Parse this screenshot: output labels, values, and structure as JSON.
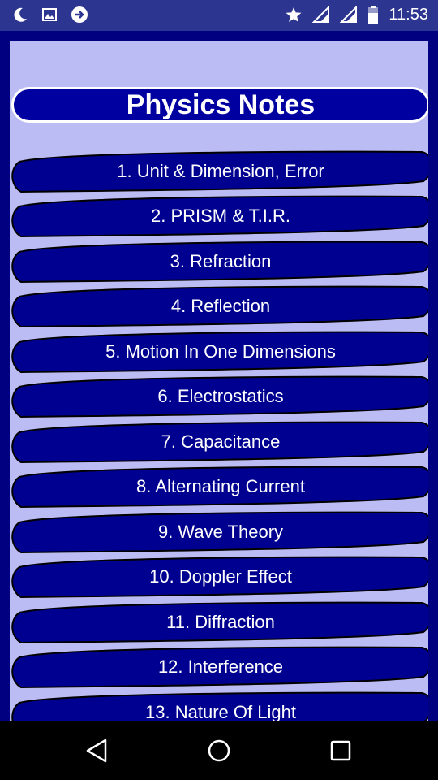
{
  "status_bar": {
    "time": "11:53",
    "icons_left": [
      "moon-icon",
      "image-icon",
      "sync-icon"
    ],
    "icons_right": [
      "star-icon",
      "signal-icon",
      "signal-icon",
      "battery-icon"
    ]
  },
  "page": {
    "title": "Physics Notes"
  },
  "topics": [
    {
      "label": "1. Unit & Dimension, Error"
    },
    {
      "label": "2. PRISM & T.I.R."
    },
    {
      "label": "3. Refraction"
    },
    {
      "label": "4. Reflection"
    },
    {
      "label": "5. Motion In One Dimensions"
    },
    {
      "label": "6. Electrostatics"
    },
    {
      "label": "7. Capacitance"
    },
    {
      "label": "8. Alternating Current"
    },
    {
      "label": "9. Wave Theory"
    },
    {
      "label": "10. Doppler Effect"
    },
    {
      "label": "11. Diffraction"
    },
    {
      "label": "12. Interference"
    },
    {
      "label": "13. Nature Of Light"
    }
  ],
  "nav_bar": {
    "icons": [
      "back-icon",
      "home-icon",
      "recents-icon"
    ]
  },
  "colors": {
    "background": "#000080",
    "panel": "#bcbcf5",
    "button": "#000090",
    "status_bar": "#2c3590",
    "text": "#ffffff"
  }
}
